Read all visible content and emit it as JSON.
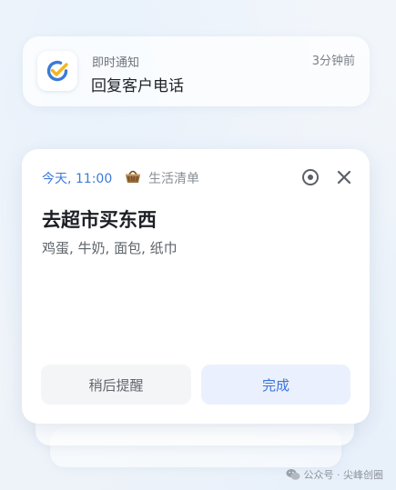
{
  "notification": {
    "app_icon": "ticktick-check-icon",
    "title": "即时通知",
    "time": "3分钟前",
    "body": "回复客户电话"
  },
  "reminder": {
    "time": "今天, 11:00",
    "list_icon": "basket-icon",
    "list_name": "生活清单",
    "title": "去超市买东西",
    "description": "鸡蛋, 牛奶, 面包, 纸巾",
    "snooze_label": "稍后提醒",
    "done_label": "完成",
    "focus_icon": "focus-target-icon",
    "close_icon": "close-icon"
  },
  "watermark": {
    "icon": "wechat-icon",
    "text": "公众号 · 尖峰创圈"
  },
  "colors": {
    "accent_blue": "#3b7bd8",
    "check_yellow": "#f5b51d",
    "done_button_bg": "#eaf0fd"
  }
}
